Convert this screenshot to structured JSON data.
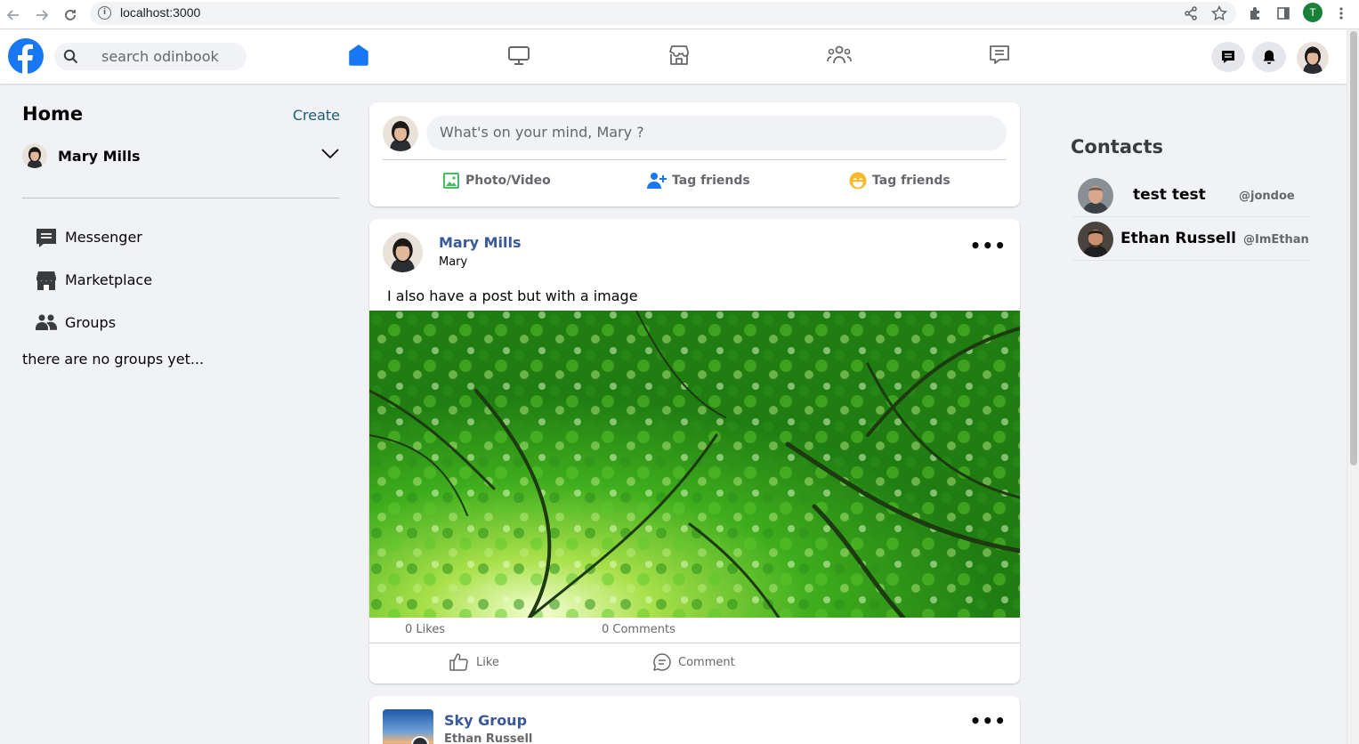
{
  "browser": {
    "url": "localhost:3000",
    "profile_initial": "T"
  },
  "header": {
    "search_placeholder": "search odinbook",
    "nav_tabs": [
      "home-icon",
      "watch-icon",
      "marketplace-icon",
      "groups-icon",
      "pages-icon"
    ],
    "active_tab": "home",
    "accent": "#1877f2"
  },
  "sidebar": {
    "title": "Home",
    "create_label": "Create",
    "user_name": "Mary Mills",
    "items": [
      {
        "label": "Messenger",
        "icon": "messenger-icon"
      },
      {
        "label": "Marketplace",
        "icon": "marketplace-icon"
      },
      {
        "label": "Groups",
        "icon": "groups-icon"
      }
    ],
    "empty_groups": "there are no groups yet..."
  },
  "composer": {
    "placeholder": "What's on your mind, Mary ?",
    "actions": [
      {
        "label": "Photo/Video",
        "icon": "photo-icon",
        "color": "#45bd62"
      },
      {
        "label": "Tag friends",
        "icon": "tag-user-icon",
        "color": "#1877f2"
      },
      {
        "label": "Tag friends",
        "icon": "smiley-icon",
        "color": "#f7b928"
      }
    ]
  },
  "post": {
    "author": "Mary Mills",
    "subtitle": "Mary",
    "text": "I also have a post but with a image",
    "likes": "0 Likes",
    "comments": "0 Comments",
    "like_label": "Like",
    "comment_label": "Comment",
    "more": "•••"
  },
  "post2": {
    "group_name": "Sky Group",
    "author": "Ethan Russell",
    "more": "•••"
  },
  "contacts": {
    "title": "Contacts",
    "list": [
      {
        "name": "test test",
        "handle": "@jondoe"
      },
      {
        "name": "Ethan Russell",
        "handle": "@ImEthan"
      }
    ]
  }
}
